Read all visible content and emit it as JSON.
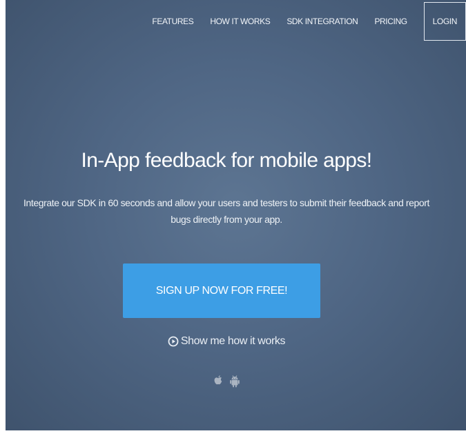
{
  "nav": {
    "items": [
      {
        "label": "FEATURES"
      },
      {
        "label": "HOW IT WORKS"
      },
      {
        "label": "SDK INTEGRATION"
      },
      {
        "label": "PRICING"
      }
    ],
    "login_label": "LOGIN"
  },
  "hero": {
    "headline": "In-App feedback for mobile apps!",
    "subtext": "Integrate our SDK in 60 seconds and allow your users and testers to submit their feedback and report bugs directly from your app.",
    "cta_label": "SIGN UP NOW FOR FREE!",
    "how_link_label": "Show me how it works",
    "platform_icons": [
      "apple-icon",
      "android-icon"
    ]
  },
  "colors": {
    "background": "#4f6684",
    "cta": "#3d9ee5",
    "text": "#ffffff"
  }
}
